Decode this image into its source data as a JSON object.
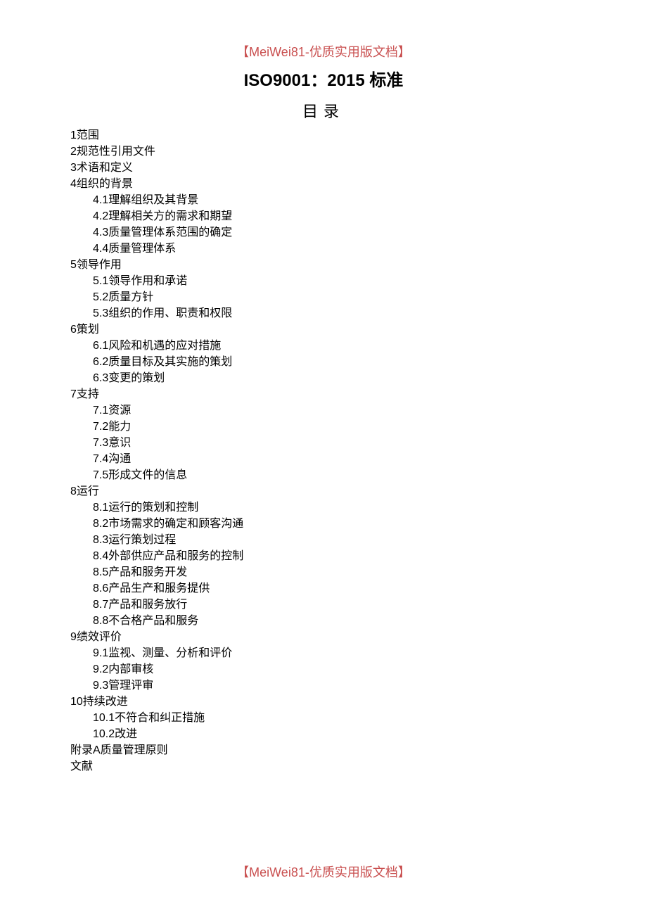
{
  "header_tag": "【MeiWei81-优质实用版文档】",
  "main_title": "ISO9001：2015 标准",
  "toc_heading": "目录",
  "footer_tag": "【MeiWei81-优质实用版文档】",
  "toc": [
    {
      "num": "1",
      "title": "范围",
      "subs": []
    },
    {
      "num": "2",
      "title": "规范性引用文件",
      "subs": []
    },
    {
      "num": "3",
      "title": "术语和定义",
      "subs": []
    },
    {
      "num": "4",
      "title": "组织的背景",
      "subs": [
        {
          "num": "4.1",
          "title": "理解组织及其背景"
        },
        {
          "num": "4.2",
          "title": "理解相关方的需求和期望"
        },
        {
          "num": "4.3",
          "title": "质量管理体系范围的确定"
        },
        {
          "num": "4.4",
          "title": "质量管理体系"
        }
      ]
    },
    {
      "num": "5",
      "title": "领导作用",
      "subs": [
        {
          "num": "5.1",
          "title": "领导作用和承诺"
        },
        {
          "num": "5.2",
          "title": "质量方针"
        },
        {
          "num": "5.3",
          "title": "组织的作用、职责和权限"
        }
      ]
    },
    {
      "num": "6",
      "title": "策划",
      "subs": [
        {
          "num": "6.1",
          "title": "风险和机遇的应对措施"
        },
        {
          "num": "6.2",
          "title": "质量目标及其实施的策划"
        },
        {
          "num": "6.3",
          "title": "变更的策划"
        }
      ]
    },
    {
      "num": "7",
      "title": "支持",
      "subs": [
        {
          "num": "7.1",
          "title": "资源"
        },
        {
          "num": "7.2",
          "title": "能力"
        },
        {
          "num": "7.3",
          "title": "意识"
        },
        {
          "num": "7.4",
          "title": "沟通"
        },
        {
          "num": "7.5",
          "title": "形成文件的信息"
        }
      ]
    },
    {
      "num": "8",
      "title": "运行",
      "subs": [
        {
          "num": "8.1",
          "title": "运行的策划和控制"
        },
        {
          "num": "8.2",
          "title": "市场需求的确定和顾客沟通"
        },
        {
          "num": "8.3",
          "title": "运行策划过程"
        },
        {
          "num": "8.4",
          "title": "外部供应产品和服务的控制"
        },
        {
          "num": "8.5",
          "title": "产品和服务开发"
        },
        {
          "num": "8.6",
          "title": "产品生产和服务提供"
        },
        {
          "num": "8.7",
          "title": "产品和服务放行"
        },
        {
          "num": "8.8",
          "title": "不合格产品和服务"
        }
      ]
    },
    {
      "num": "9",
      "title": "绩效评价",
      "subs": [
        {
          "num": "9.1",
          "title": "监视、测量、分析和评价"
        },
        {
          "num": "9.2",
          "title": "内部审核"
        },
        {
          "num": "9.3",
          "title": "管理评审"
        }
      ]
    },
    {
      "num": "10",
      "title": "持续改进",
      "subs": [
        {
          "num": "10.1",
          "title": "不符合和纠正措施"
        },
        {
          "num": "10.2",
          "title": "改进"
        }
      ]
    },
    {
      "num": "附录A",
      "title": "质量管理原则",
      "subs": []
    },
    {
      "num": "文献",
      "title": "",
      "subs": []
    }
  ]
}
